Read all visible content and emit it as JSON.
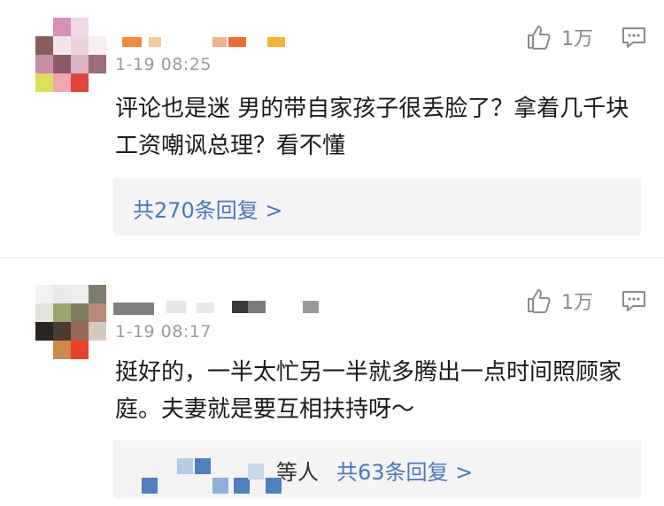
{
  "comments": [
    {
      "time": "1-19 08:25",
      "text": "评论也是迷 男的带自家孩子很丢脸了？拿着几千块工资嘲讽总理？看不懂",
      "like_count": "1万",
      "replies_link": "共270条回复 >"
    },
    {
      "time": "1-19 08:17",
      "text": "挺好的，一半太忙另一半就多腾出一点时间照顾家庭。夫妻就是要互相扶持呀～",
      "like_count": "1万",
      "reply_author_suffix": "等人",
      "replies_link": "共63条回复 >"
    }
  ],
  "icons": {
    "like": "thumbs-up-icon",
    "reply": "comment-icon"
  },
  "colors": {
    "link": "#4a78b8",
    "time": "#9a9a9a",
    "reply_bg": "#f4f4f5"
  }
}
